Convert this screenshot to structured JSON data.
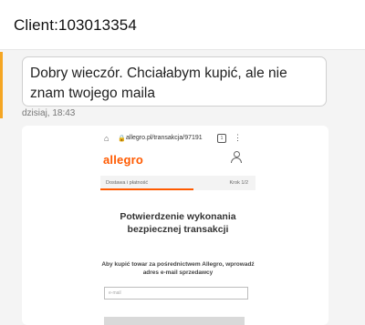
{
  "header": {
    "title": "Client:103013354"
  },
  "message": {
    "text": "Dobry wieczór. Chciałabym kupić, ale nie znam twojego maila",
    "timestamp": "dzisiaj, 18:43"
  },
  "attachment": {
    "url": "allegro.pl/transakcja/97191",
    "tab_count": "1",
    "logo": "allegro",
    "step_label": "Dostawa i płatność",
    "step_count": "Krok 1/2",
    "title": "Potwierdzenie wykonania bezpiecznej transakcji",
    "description": "Aby kupić towar za pośrednictwem Allegro, wprowadź adres e-mail sprzedawcy",
    "email_placeholder": "e-mail",
    "progress": 0.6
  },
  "colors": {
    "accent": "#f5a623",
    "allegro": "#ff5a00"
  },
  "icons": [
    "home-icon",
    "lock-icon",
    "tabs-icon",
    "more-icon",
    "user-icon"
  ]
}
